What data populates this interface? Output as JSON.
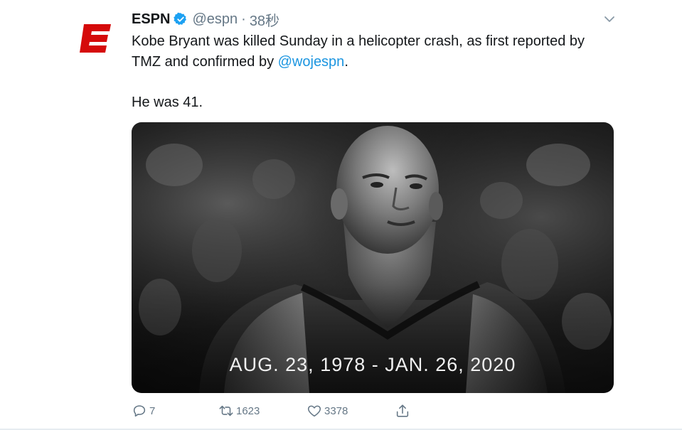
{
  "tweet": {
    "author": {
      "name": "ESPN",
      "handle": "@espn",
      "separator": "·",
      "time": "38秒",
      "avatar_icon": "espn-e-logo",
      "verified_icon": "verified-badge-icon"
    },
    "text": {
      "line1_before_mention": "Kobe Bryant was killed Sunday in a helicopter crash, as first reported by TMZ and confirmed by ",
      "mention": "@wojespn",
      "line1_after_mention": ".",
      "line2": "He was 41."
    },
    "media": {
      "caption": "AUG. 23, 1978 - JAN. 26, 2020"
    },
    "actions": {
      "reply_count": "7",
      "retweet_count": "1623",
      "like_count": "3378"
    }
  },
  "colors": {
    "brand_red": "#d50a0a",
    "verified_blue": "#1da1f2",
    "link_blue": "#1b95e0",
    "muted_gray": "#657786"
  }
}
